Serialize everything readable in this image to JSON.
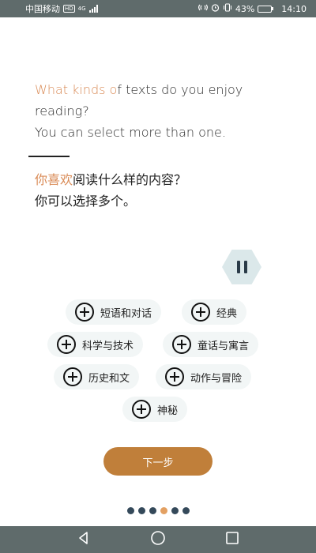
{
  "status_bar": {
    "carrier": "中国移动",
    "hd": "HD",
    "network": "4G",
    "battery": "43%",
    "battery_level": 0.43,
    "time": "14:10"
  },
  "prompt": {
    "en_highlight": "What kinds o",
    "en_rest": "f texts do you enjoy reading?",
    "en_line2": "You can select more than one.",
    "zh_highlight": "你喜欢",
    "zh_rest": "阅读什么样的内容？",
    "zh_line2": "你可以选择多个。"
  },
  "options": [
    {
      "label": "短语和对话"
    },
    {
      "label": "经典"
    },
    {
      "label": "科学与技术"
    },
    {
      "label": "童话与寓言"
    },
    {
      "label": "历史和文"
    },
    {
      "label": "动作与冒险"
    },
    {
      "label": "神秘"
    }
  ],
  "next_button": {
    "label": "下一步"
  },
  "pager": {
    "total": 6,
    "active_index": 3
  },
  "colors": {
    "highlight": "#d98a55",
    "next_button": "#c07f3a",
    "pause_bg": "#dbe8ea",
    "dot": "#34495a",
    "dot_active": "#e3a062",
    "system_bar": "#5f6b6b"
  }
}
